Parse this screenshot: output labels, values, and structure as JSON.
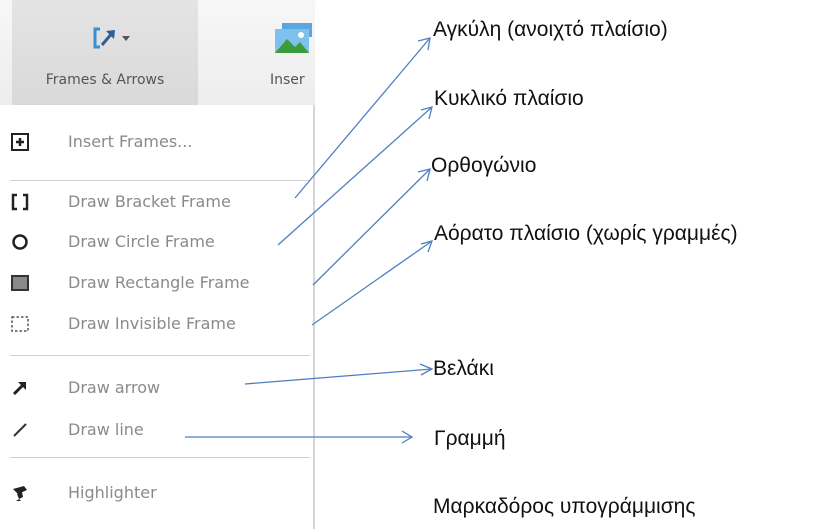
{
  "ribbon": {
    "frames_button": {
      "label": "Frames & Arrows",
      "icon": "frames-arrows-icon"
    },
    "insert_button": {
      "label": "Inser",
      "icon": "image-icon"
    }
  },
  "menu": {
    "items": [
      {
        "label": "Insert Frames...",
        "icon": "plus-box-icon"
      },
      {
        "label": "Draw Bracket Frame",
        "icon": "bracket-icon"
      },
      {
        "label": "Draw Circle Frame",
        "icon": "circle-icon"
      },
      {
        "label": "Draw Rectangle Frame",
        "icon": "rectangle-icon"
      },
      {
        "label": "Draw Invisible Frame",
        "icon": "dashed-rectangle-icon"
      },
      {
        "label": "Draw arrow",
        "icon": "arrow-icon"
      },
      {
        "label": "Draw line",
        "icon": "line-icon"
      },
      {
        "label": "Highlighter",
        "icon": "highlighter-icon"
      }
    ]
  },
  "annotations": [
    "Αγκύλη (ανοιχτό πλαίσιο)",
    "Κυκλικό πλαίσιο",
    "Ορθογώνιο",
    "Αόρατο πλαίσιο (χωρίς γραμμές)",
    "Βελάκι",
    "Γραμμή",
    "Μαρκαδόρος υπογράμμισης"
  ],
  "colors": {
    "arrow": "#4f7fc3",
    "menu_text": "#8a8a8a",
    "ribbon_active": "#dcdcdc"
  }
}
